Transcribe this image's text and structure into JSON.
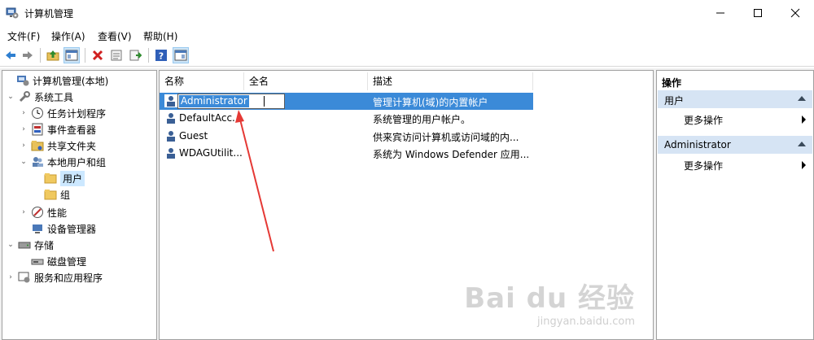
{
  "window": {
    "title": "计算机管理"
  },
  "menu": [
    "文件(F)",
    "操作(A)",
    "查看(V)",
    "帮助(H)"
  ],
  "toolbar": {
    "icons": [
      "back-icon",
      "forward-icon",
      "up-folder-icon",
      "show-tree-icon",
      "delete-icon",
      "properties-icon",
      "export-icon",
      "help-icon",
      "show-action-pane-icon"
    ]
  },
  "tree": {
    "root": "计算机管理(本地)",
    "system_tools": "系统工具",
    "task_scheduler": "任务计划程序",
    "event_viewer": "事件查看器",
    "shared_folders": "共享文件夹",
    "local_users_groups": "本地用户和组",
    "users": "用户",
    "groups": "组",
    "performance": "性能",
    "device_manager": "设备管理器",
    "storage": "存储",
    "disk_management": "磁盘管理",
    "services_apps": "服务和应用程序"
  },
  "list": {
    "columns": {
      "name": "名称",
      "fullname": "全名",
      "description": "描述"
    },
    "rows": [
      {
        "name": "Administrator",
        "fullname": "",
        "description": "管理计算机(域)的内置帐户"
      },
      {
        "name": "DefaultAcc...",
        "fullname": "",
        "description": "系统管理的用户帐户。"
      },
      {
        "name": "Guest",
        "fullname": "",
        "description": "供来宾访问计算机或访问域的内..."
      },
      {
        "name": "WDAGUtilit...",
        "fullname": "",
        "description": "系统为 Windows Defender 应用..."
      }
    ],
    "editing_value": "Administrator"
  },
  "actions": {
    "title": "操作",
    "sections": [
      {
        "header": "用户",
        "item": "更多操作"
      },
      {
        "header": "Administrator",
        "item": "更多操作"
      }
    ]
  },
  "watermark": {
    "brand": "Bai du 经验",
    "url": "jingyan.baidu.com"
  },
  "colors": {
    "selection": "#3b8ad8",
    "section_header": "#d6e4f4",
    "annotation_arrow": "#e53935"
  }
}
